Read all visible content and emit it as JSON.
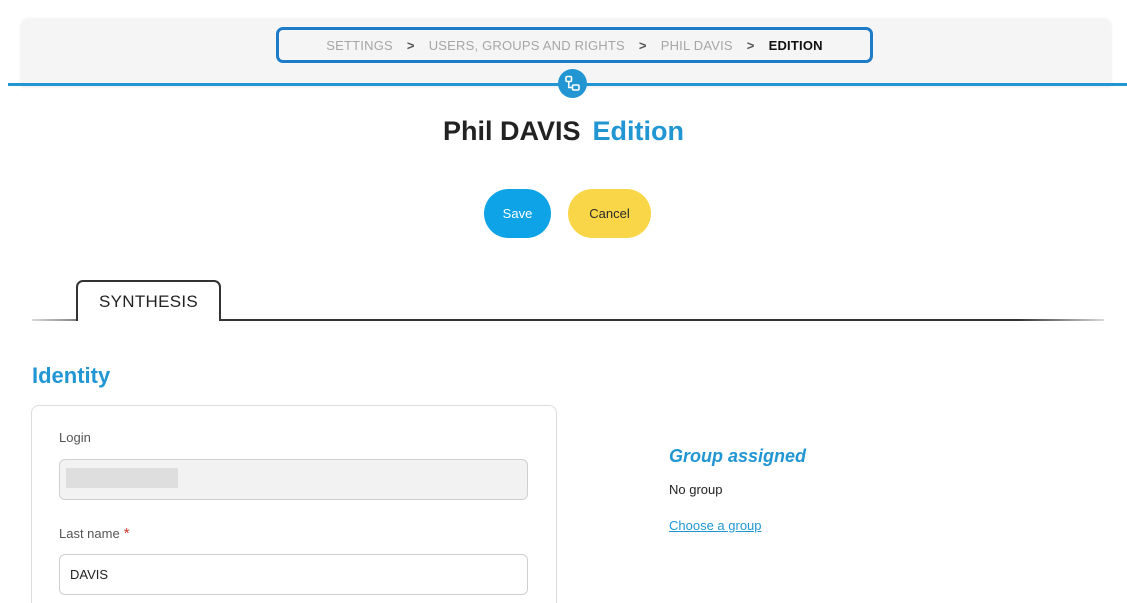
{
  "breadcrumb": {
    "items": [
      "SETTINGS",
      "USERS, GROUPS AND RIGHTS",
      "PHIL DAVIS"
    ],
    "current": "EDITION",
    "separator": ">"
  },
  "header": {
    "name": "Phil DAVIS",
    "mode": "Edition"
  },
  "actions": {
    "save_label": "Save",
    "cancel_label": "Cancel"
  },
  "tabs": [
    {
      "label": "SYNTHESIS",
      "active": true
    }
  ],
  "identity": {
    "title": "Identity",
    "login": {
      "label": "Login",
      "value": ""
    },
    "last_name": {
      "label": "Last name",
      "required_mark": "*",
      "value": "DAVIS"
    }
  },
  "group": {
    "title": "Group assigned",
    "value": "No group",
    "link_label": "Choose a group"
  },
  "colors": {
    "accent": "#2196d3",
    "save": "#0ea3e6",
    "cancel": "#f9d548",
    "required": "#d0342c"
  },
  "icons": {
    "breadcrumb_separator": "chevron-right-icon",
    "tree": "tree-structure-icon"
  }
}
